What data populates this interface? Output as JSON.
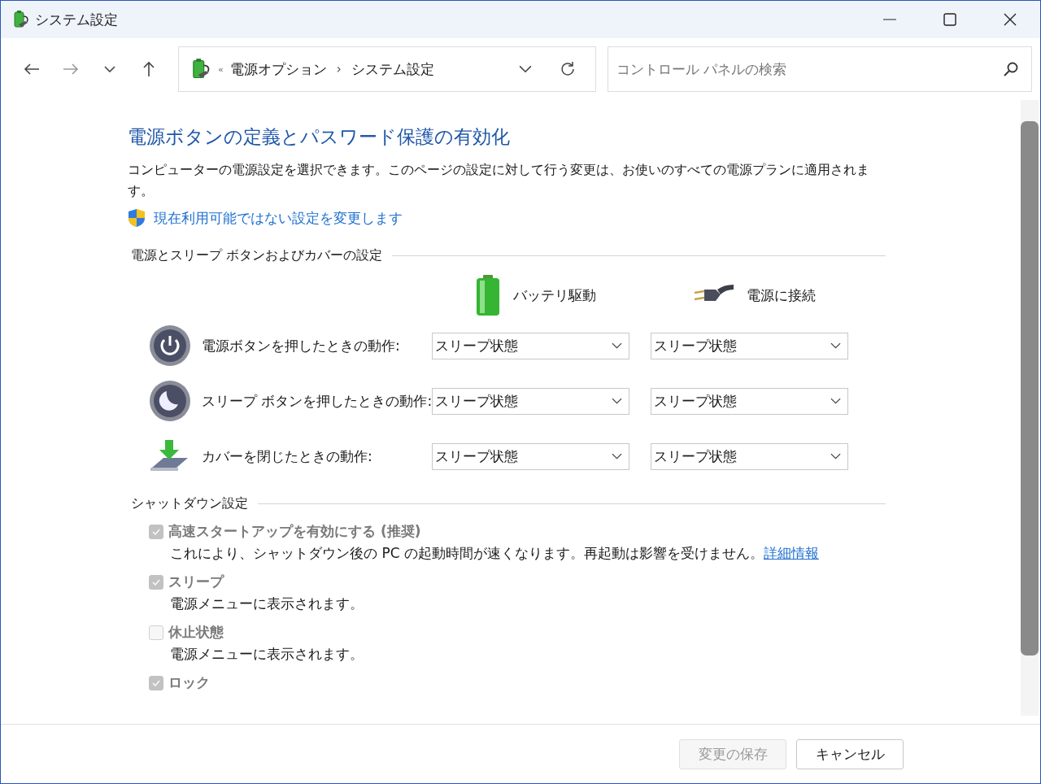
{
  "window": {
    "title": "システム設定"
  },
  "nav": {
    "forward": {
      "disabled": true
    },
    "overflow": "«",
    "separator": "›",
    "breadcrumb": [
      "電源オプション",
      "システム設定"
    ],
    "search": {
      "placeholder": "コントロール パネルの検索"
    }
  },
  "page": {
    "heading": "電源ボタンの定義とパスワード保護の有効化",
    "description": "コンピューターの電源設定を選択できます。このページの設定に対して行う変更は、お使いのすべての電源プランに適用されます。",
    "admin_link": "現在利用可能ではない設定を変更します"
  },
  "power_section": {
    "title": "電源とスリープ ボタンおよびカバーの設定",
    "columns": [
      {
        "kind": "battery",
        "label": "バッテリ駆動"
      },
      {
        "kind": "plug",
        "label": "電源に接続"
      }
    ],
    "rows": [
      {
        "kind": "power",
        "label": "電源ボタンを押したときの動作:",
        "values": [
          "スリープ状態",
          "スリープ状態"
        ]
      },
      {
        "kind": "sleep",
        "label": "スリープ ボタンを押したときの動作:",
        "values": [
          "スリープ状態",
          "スリープ状態"
        ]
      },
      {
        "kind": "lid",
        "label": "カバーを閉じたときの動作:",
        "values": [
          "スリープ状態",
          "スリープ状態"
        ]
      }
    ]
  },
  "shutdown_section": {
    "title": "シャットダウン設定",
    "options": [
      {
        "label": "高速スタートアップを有効にする (推奨)",
        "checked": true,
        "disabled": true,
        "description": "これにより、シャットダウン後の PC の起動時間が速くなります。再起動は影響を受けません。",
        "link": "詳細情報"
      },
      {
        "label": "スリープ",
        "checked": true,
        "disabled": true,
        "description": "電源メニューに表示されます。"
      },
      {
        "label": "休止状態",
        "checked": false,
        "disabled": true,
        "description": "電源メニューに表示されます。"
      },
      {
        "label": "ロック",
        "checked": true,
        "disabled": true
      }
    ]
  },
  "buttons": [
    {
      "label": "変更の保存",
      "disabled": true
    },
    {
      "label": "キャンセル",
      "disabled": false
    }
  ]
}
